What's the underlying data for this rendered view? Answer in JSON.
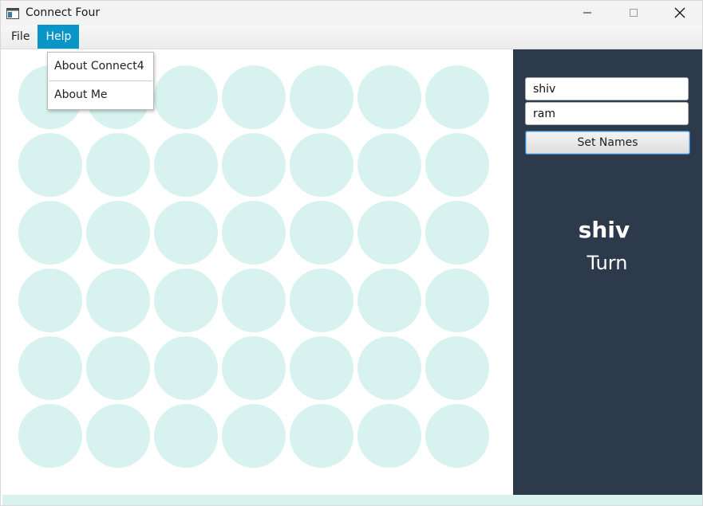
{
  "window": {
    "title": "Connect Four"
  },
  "menubar": {
    "items": [
      {
        "label": "File"
      },
      {
        "label": "Help"
      }
    ]
  },
  "help_menu": {
    "items": [
      {
        "label": "About Connect4"
      },
      {
        "label": "About Me"
      }
    ]
  },
  "board": {
    "rows": 6,
    "columns": 7,
    "empty_color": "#d8f3ef"
  },
  "panel": {
    "player1_value": "shiv",
    "player2_value": "ram",
    "set_button_label": "Set Names",
    "current_player": "shiv",
    "turn_label": "Turn"
  },
  "colors": {
    "panel_bg": "#2c3a4b",
    "menu_active": "#0896c8"
  }
}
